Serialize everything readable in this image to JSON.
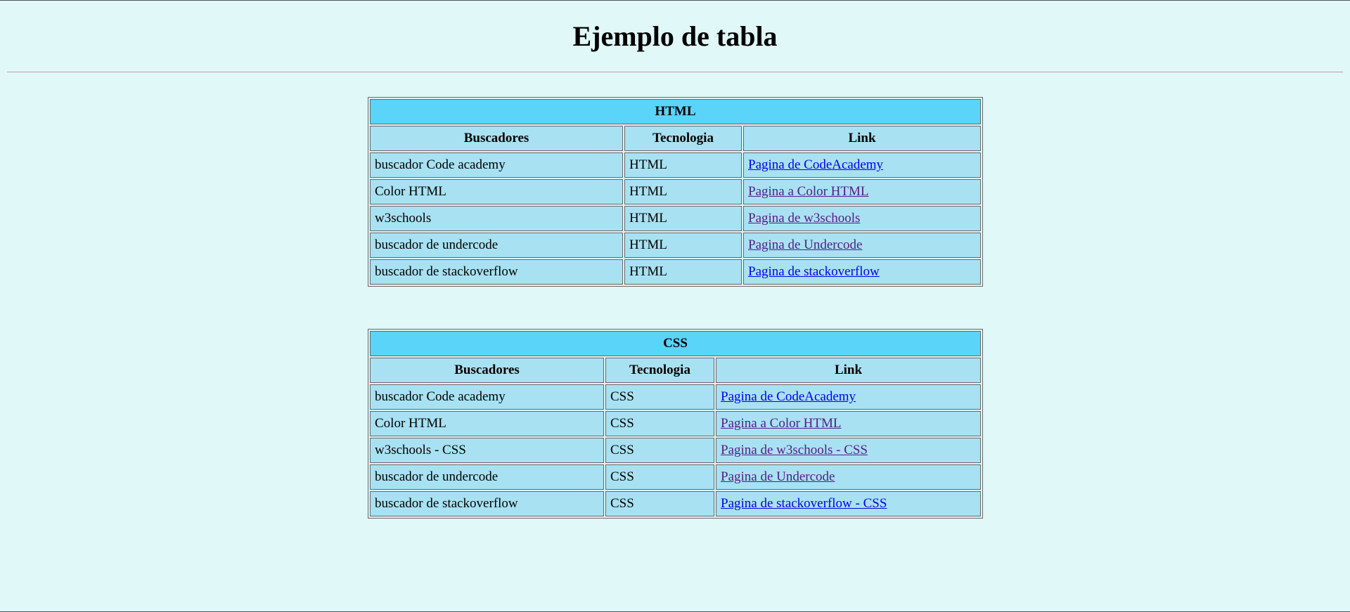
{
  "page": {
    "title": "Ejemplo de tabla"
  },
  "tables": [
    {
      "caption": "HTML",
      "headers": [
        "Buscadores",
        "Tecnologia",
        "Link"
      ],
      "rows": [
        {
          "buscador": "buscador Code academy",
          "tecnologia": "HTML",
          "link": "Pagina de CodeAcademy",
          "visited": false
        },
        {
          "buscador": "Color HTML",
          "tecnologia": "HTML",
          "link": "Pagina a Color HTML",
          "visited": true
        },
        {
          "buscador": "w3schools",
          "tecnologia": "HTML",
          "link": "Pagina de w3schools",
          "visited": true
        },
        {
          "buscador": "buscador de undercode",
          "tecnologia": "HTML",
          "link": "Pagina de Undercode",
          "visited": true
        },
        {
          "buscador": "buscador de stackoverflow",
          "tecnologia": "HTML",
          "link": "Pagina de stackoverflow",
          "visited": false
        }
      ]
    },
    {
      "caption": "CSS",
      "headers": [
        "Buscadores",
        "Tecnologia",
        "Link"
      ],
      "rows": [
        {
          "buscador": "buscador Code academy",
          "tecnologia": "CSS",
          "link": "Pagina de CodeAcademy",
          "visited": false
        },
        {
          "buscador": "Color HTML",
          "tecnologia": "CSS",
          "link": "Pagina a Color HTML",
          "visited": true
        },
        {
          "buscador": "w3schools - CSS",
          "tecnologia": "CSS",
          "link": "Pagina de w3schools - CSS",
          "visited": true
        },
        {
          "buscador": "buscador de undercode",
          "tecnologia": "CSS",
          "link": "Pagina de Undercode",
          "visited": true
        },
        {
          "buscador": "buscador de stackoverflow",
          "tecnologia": "CSS",
          "link": "Pagina de stackoverflow - CSS",
          "visited": false
        }
      ]
    }
  ],
  "colors": {
    "page_background": "#e0f8f8",
    "caption_background": "#5ad4f8",
    "cell_background": "#a8e2f2",
    "link": "#0000ee",
    "link_visited": "#551a8b"
  }
}
